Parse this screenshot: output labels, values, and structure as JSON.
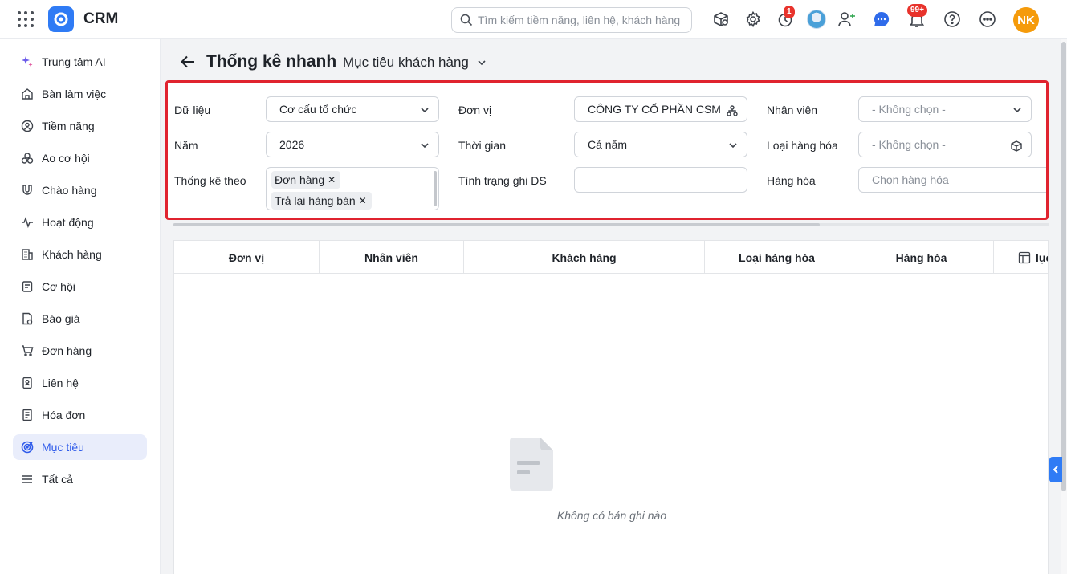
{
  "app": {
    "name": "CRM"
  },
  "search": {
    "placeholder": "Tìm kiếm tiềm năng, liên hệ, khách hàng"
  },
  "topbar": {
    "timer_badge": "1",
    "notification_badge": "99+",
    "user_initials": "NK",
    "colors": {
      "brand": "#2f7bf5",
      "badge": "#e8332c",
      "avatar": "#f59b0b"
    }
  },
  "sidebar": {
    "items": [
      {
        "label": "Trung tâm AI",
        "icon": "sparkle-icon"
      },
      {
        "label": "Bàn làm việc",
        "icon": "home-icon"
      },
      {
        "label": "Tiềm năng",
        "icon": "prospect-icon"
      },
      {
        "label": "Ao cơ hội",
        "icon": "pool-icon"
      },
      {
        "label": "Chào hàng",
        "icon": "magnet-icon"
      },
      {
        "label": "Hoạt động",
        "icon": "activity-icon"
      },
      {
        "label": "Khách hàng",
        "icon": "building-icon"
      },
      {
        "label": "Cơ hội",
        "icon": "opportunity-icon"
      },
      {
        "label": "Báo giá",
        "icon": "quote-icon"
      },
      {
        "label": "Đơn hàng",
        "icon": "cart-icon"
      },
      {
        "label": "Liên hệ",
        "icon": "contact-icon"
      },
      {
        "label": "Hóa đơn",
        "icon": "invoice-icon"
      },
      {
        "label": "Mục tiêu",
        "icon": "target-icon",
        "active": true
      },
      {
        "label": "Tất cả",
        "icon": "menu-icon"
      }
    ]
  },
  "page": {
    "title": "Thống kê nhanh",
    "subtitle": "Mục tiêu khách hàng"
  },
  "filters": {
    "du_lieu": {
      "label": "Dữ liệu",
      "value": "Cơ cấu tổ chức"
    },
    "don_vi": {
      "label": "Đơn vị",
      "value": "CÔNG TY CỔ PHẦN CSM"
    },
    "nhan_vien": {
      "label": "Nhân viên",
      "placeholder": "- Không chọn -"
    },
    "nam": {
      "label": "Năm",
      "value": "2026"
    },
    "thoi_gian": {
      "label": "Thời gian",
      "value": "Cả năm"
    },
    "loai_hang_hoa": {
      "label": "Loại hàng hóa",
      "placeholder": "- Không chọn -"
    },
    "thong_ke_theo": {
      "label": "Thống kê theo",
      "tags": [
        "Đơn hàng",
        "Trả lại hàng bán"
      ]
    },
    "tinh_trang": {
      "label": "Tình trạng ghi DS",
      "value": ""
    },
    "hang_hoa": {
      "label": "Hàng hóa",
      "placeholder": "Chọn hàng hóa"
    }
  },
  "table": {
    "columns": [
      "Đơn vị",
      "Nhân viên",
      "Khách hàng",
      "Loại hàng hóa",
      "Hàng hóa",
      "lục"
    ],
    "empty_text": "Không có bản ghi nào",
    "rows": []
  }
}
